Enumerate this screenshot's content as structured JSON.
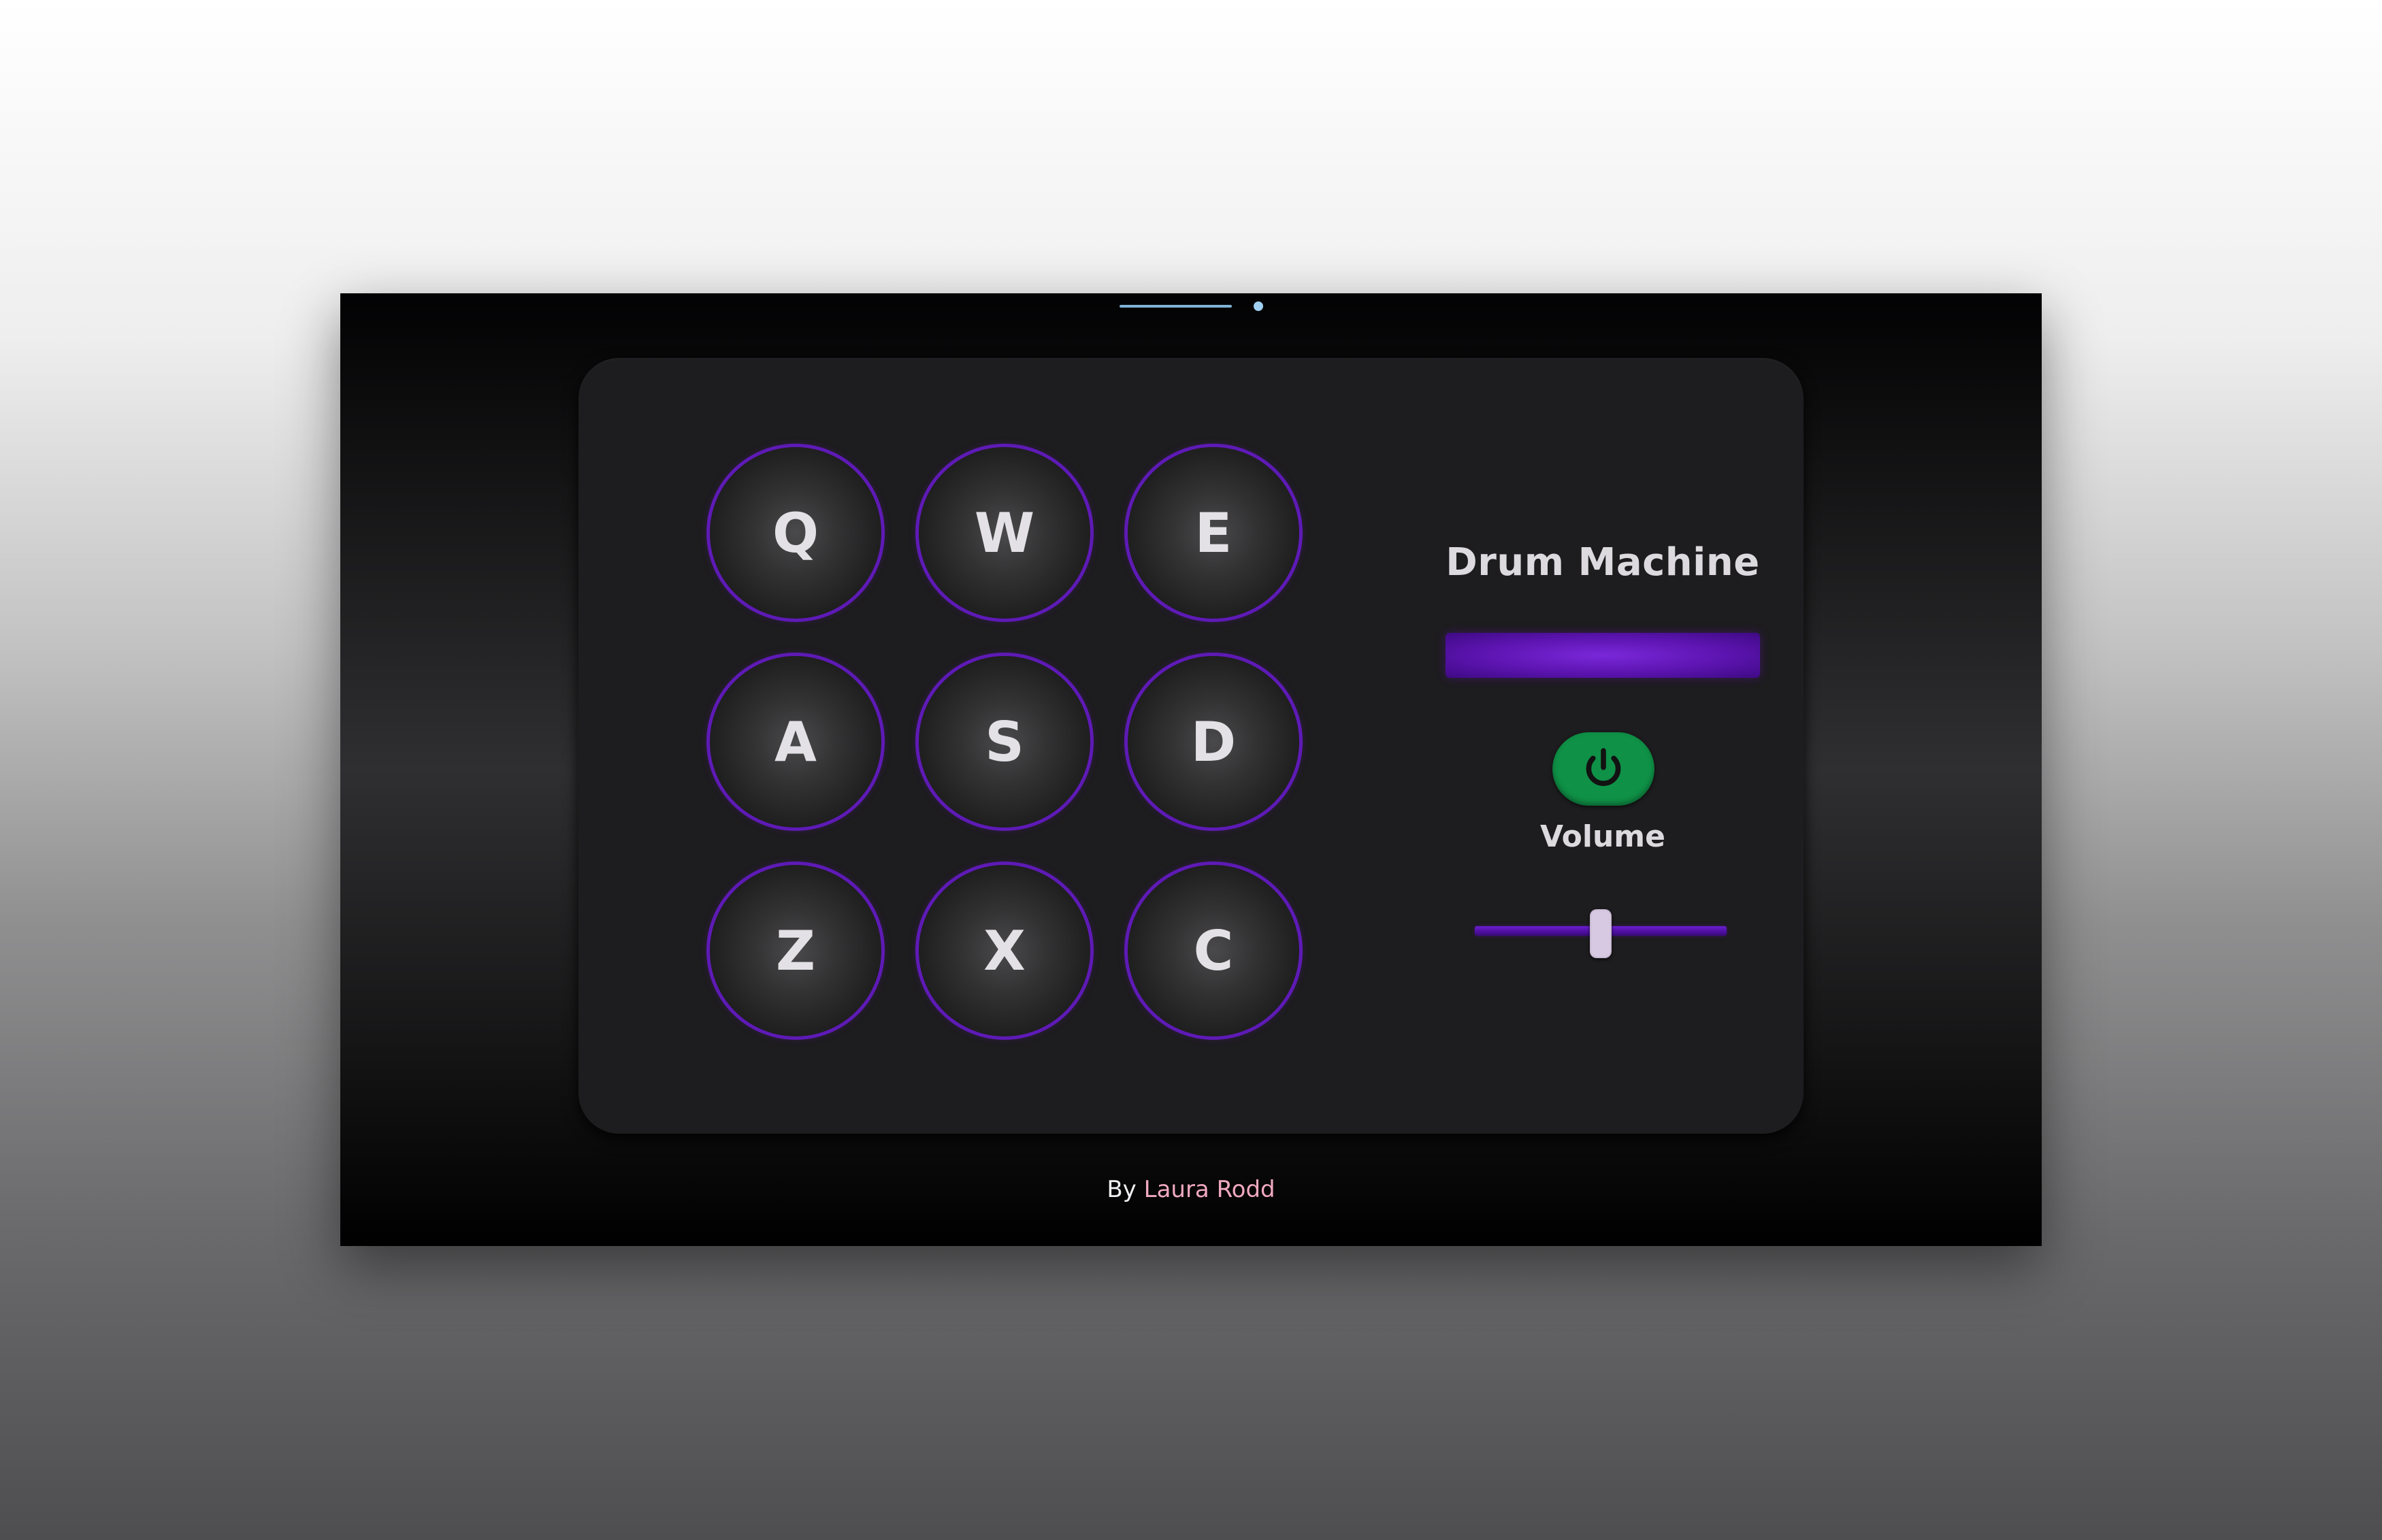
{
  "app": {
    "title": "Drum Machine",
    "display_text": "",
    "volume_label": "Volume",
    "volume_level": 0.5,
    "power_on": true
  },
  "pads": [
    {
      "key": "Q"
    },
    {
      "key": "W"
    },
    {
      "key": "E"
    },
    {
      "key": "A"
    },
    {
      "key": "S"
    },
    {
      "key": "D"
    },
    {
      "key": "Z"
    },
    {
      "key": "X"
    },
    {
      "key": "C"
    }
  ],
  "footer": {
    "by_label": "By",
    "author": "Laura Rodd"
  },
  "colors": {
    "accent_purple": "#5e1ab6",
    "power_green": "#0f9147",
    "author_link": "#f0a9c1"
  },
  "icons": {
    "power": "power-icon"
  }
}
